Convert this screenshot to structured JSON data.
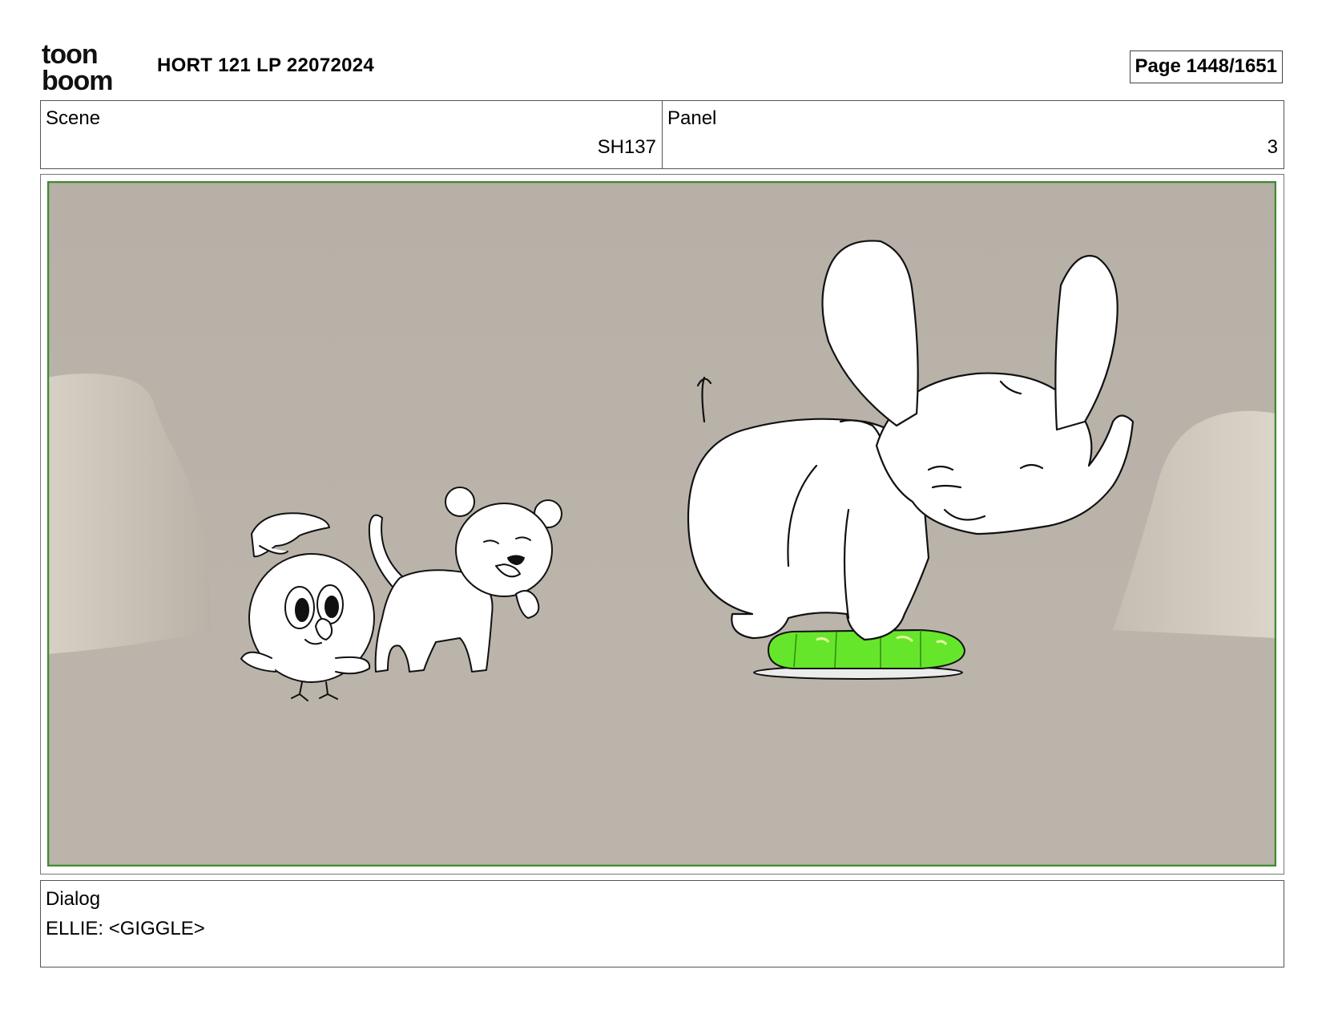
{
  "header": {
    "logo": {
      "line1": "toon",
      "line2": "boom",
      "icon": "toonboom-logo"
    },
    "title": "HORT 121 LP 22072024",
    "page": "Page 1448/1651"
  },
  "scene": {
    "label": "Scene",
    "value": "SH137"
  },
  "panel": {
    "label": "Panel",
    "value": "3"
  },
  "artwork": {
    "description_icons": [
      "bird-character",
      "cat-character",
      "elephant-character",
      "green-cushion"
    ],
    "frame_color": "#3f8a2f",
    "background_color": "#bab4ac",
    "cushion_color": "#66e62a"
  },
  "dialog": {
    "label": "Dialog",
    "text": "ELLIE: <GIGGLE>"
  }
}
